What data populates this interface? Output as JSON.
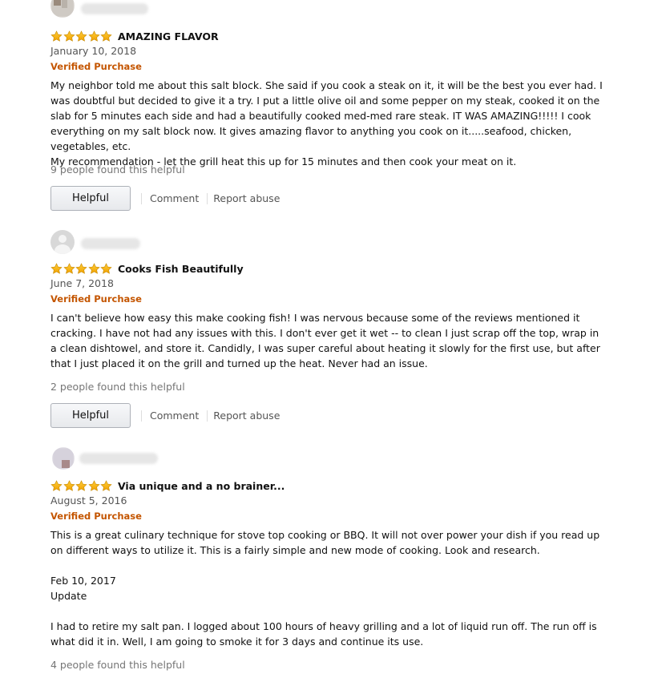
{
  "reviews": [
    {
      "rating": 5,
      "title": "AMAZING FLAVOR",
      "date": "January 10, 2018",
      "verified": "Verified Purchase",
      "body": "My neighbor told me about this salt block. She said if you cook a steak on it, it will be the best you ever had. I was doubtful but decided to give it a try. I put a little olive oil and some pepper on my steak, cooked it on the slab for 5 minutes each side and had a beautifully cooked med-med rare steak. IT WAS AMAZING!!!!! I cook everything on my salt block now. It gives amazing flavor to anything you cook on it.....seafood, chicken, vegetables, etc.\nMy recommendation - let the grill heat this up for 15 minutes and then cook your meat on it.",
      "helpful_count": "9 people found this helpful",
      "helpful_button": "Helpful",
      "comment": "Comment",
      "report": "Report abuse"
    },
    {
      "rating": 5,
      "title": "Cooks Fish Beautifully",
      "date": "June 7, 2018",
      "verified": "Verified Purchase",
      "body": "I can't believe how easy this make cooking fish! I was nervous because some of the reviews mentioned it cracking. I have not had any issues with this. I don't ever get it wet -- to clean I just scrap off the top, wrap in a clean dishtowel, and store it. Candidly, I was super careful about heating it slowly for the first use, but after that I just placed it on the grill and turned up the heat. Never had an issue.",
      "helpful_count": "2 people found this helpful",
      "helpful_button": "Helpful",
      "comment": "Comment",
      "report": "Report abuse"
    },
    {
      "rating": 5,
      "title": "Via unique and a no brainer...",
      "date": "August 5, 2016",
      "verified": "Verified Purchase",
      "body": "This is a great culinary technique for stove top cooking or BBQ. It will not over power your dish if you read up on different ways to utilize it. This is a fairly simple and new mode of cooking. Look and research.\n\nFeb 10, 2017\nUpdate\n\nI had to retire my salt pan. I logged about 100 hours of heavy grilling and a lot of liquid run off. The run off is what did it in. Well, I am going to smoke it for 3 days and continue its use.",
      "helpful_count": "4 people found this helpful"
    }
  ],
  "colors": {
    "star": "#f0a80a",
    "verified": "#c45500",
    "muted": "#767676"
  },
  "icons": {
    "star": "star-icon",
    "avatar": "default-avatar-icon"
  }
}
